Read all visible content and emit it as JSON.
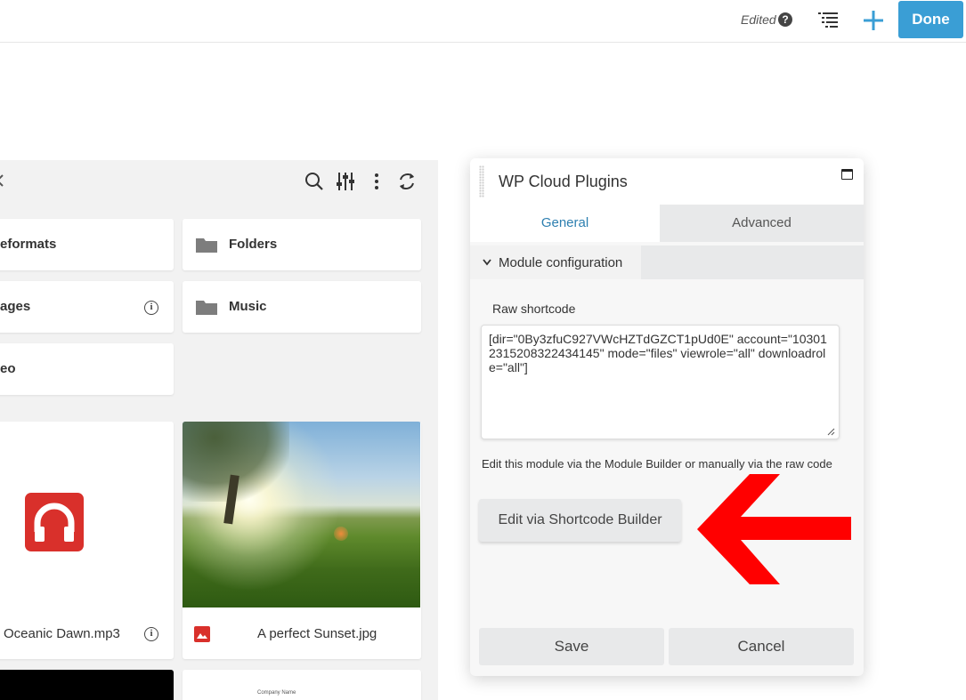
{
  "topbar": {
    "status": "Edited",
    "done_label": "Done",
    "icons": [
      "help-icon",
      "outline-list-icon",
      "plus-icon"
    ],
    "accent": "#3a9ed5"
  },
  "browser": {
    "toolbar_icons": [
      "search-icon",
      "filter-sliders-icon",
      "more-vertical-icon",
      "refresh-icon"
    ],
    "folders": [
      {
        "label": "eformats"
      },
      {
        "label": "Folders"
      },
      {
        "label": "ages"
      },
      {
        "label": "Music"
      },
      {
        "label": "eo"
      }
    ],
    "files": [
      {
        "name": "Oceanic Dawn.mp3",
        "icon": "headphones-icon"
      },
      {
        "name": "A perfect Sunset.jpg",
        "icon": "image-icon"
      }
    ],
    "thumb_text": {
      "company": "Company Name"
    }
  },
  "panel": {
    "title": "WP Cloud Plugins",
    "tabs": {
      "general": "General",
      "advanced": "Advanced"
    },
    "section": "Module configuration",
    "field_label": "Raw shortcode",
    "shortcode": "[dir=\"0By3zfuC927VWcHZTdGZCT1pUd0E\" account=\"103012315208322434145\" mode=\"files\" viewrole=\"all\" downloadrole=\"all\"]",
    "help_text": "Edit this module via the Module Builder or manually via the raw code",
    "builder_label": "Edit via Shortcode Builder",
    "save_label": "Save",
    "cancel_label": "Cancel",
    "tab_active_color": "#2d7fb0"
  },
  "annotation": {
    "arrow_color": "#ff0000"
  }
}
